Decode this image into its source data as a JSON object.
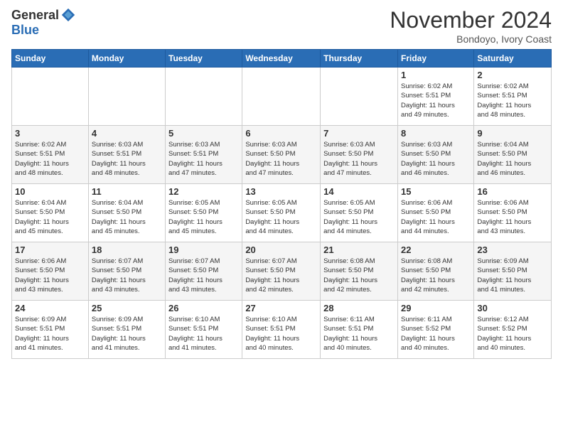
{
  "logo": {
    "general": "General",
    "blue": "Blue"
  },
  "title": "November 2024",
  "subtitle": "Bondoyo, Ivory Coast",
  "days_header": [
    "Sunday",
    "Monday",
    "Tuesday",
    "Wednesday",
    "Thursday",
    "Friday",
    "Saturday"
  ],
  "weeks": [
    [
      {
        "day": "",
        "info": ""
      },
      {
        "day": "",
        "info": ""
      },
      {
        "day": "",
        "info": ""
      },
      {
        "day": "",
        "info": ""
      },
      {
        "day": "",
        "info": ""
      },
      {
        "day": "1",
        "info": "Sunrise: 6:02 AM\nSunset: 5:51 PM\nDaylight: 11 hours\nand 49 minutes."
      },
      {
        "day": "2",
        "info": "Sunrise: 6:02 AM\nSunset: 5:51 PM\nDaylight: 11 hours\nand 48 minutes."
      }
    ],
    [
      {
        "day": "3",
        "info": "Sunrise: 6:02 AM\nSunset: 5:51 PM\nDaylight: 11 hours\nand 48 minutes."
      },
      {
        "day": "4",
        "info": "Sunrise: 6:03 AM\nSunset: 5:51 PM\nDaylight: 11 hours\nand 48 minutes."
      },
      {
        "day": "5",
        "info": "Sunrise: 6:03 AM\nSunset: 5:51 PM\nDaylight: 11 hours\nand 47 minutes."
      },
      {
        "day": "6",
        "info": "Sunrise: 6:03 AM\nSunset: 5:50 PM\nDaylight: 11 hours\nand 47 minutes."
      },
      {
        "day": "7",
        "info": "Sunrise: 6:03 AM\nSunset: 5:50 PM\nDaylight: 11 hours\nand 47 minutes."
      },
      {
        "day": "8",
        "info": "Sunrise: 6:03 AM\nSunset: 5:50 PM\nDaylight: 11 hours\nand 46 minutes."
      },
      {
        "day": "9",
        "info": "Sunrise: 6:04 AM\nSunset: 5:50 PM\nDaylight: 11 hours\nand 46 minutes."
      }
    ],
    [
      {
        "day": "10",
        "info": "Sunrise: 6:04 AM\nSunset: 5:50 PM\nDaylight: 11 hours\nand 45 minutes."
      },
      {
        "day": "11",
        "info": "Sunrise: 6:04 AM\nSunset: 5:50 PM\nDaylight: 11 hours\nand 45 minutes."
      },
      {
        "day": "12",
        "info": "Sunrise: 6:05 AM\nSunset: 5:50 PM\nDaylight: 11 hours\nand 45 minutes."
      },
      {
        "day": "13",
        "info": "Sunrise: 6:05 AM\nSunset: 5:50 PM\nDaylight: 11 hours\nand 44 minutes."
      },
      {
        "day": "14",
        "info": "Sunrise: 6:05 AM\nSunset: 5:50 PM\nDaylight: 11 hours\nand 44 minutes."
      },
      {
        "day": "15",
        "info": "Sunrise: 6:06 AM\nSunset: 5:50 PM\nDaylight: 11 hours\nand 44 minutes."
      },
      {
        "day": "16",
        "info": "Sunrise: 6:06 AM\nSunset: 5:50 PM\nDaylight: 11 hours\nand 43 minutes."
      }
    ],
    [
      {
        "day": "17",
        "info": "Sunrise: 6:06 AM\nSunset: 5:50 PM\nDaylight: 11 hours\nand 43 minutes."
      },
      {
        "day": "18",
        "info": "Sunrise: 6:07 AM\nSunset: 5:50 PM\nDaylight: 11 hours\nand 43 minutes."
      },
      {
        "day": "19",
        "info": "Sunrise: 6:07 AM\nSunset: 5:50 PM\nDaylight: 11 hours\nand 43 minutes."
      },
      {
        "day": "20",
        "info": "Sunrise: 6:07 AM\nSunset: 5:50 PM\nDaylight: 11 hours\nand 42 minutes."
      },
      {
        "day": "21",
        "info": "Sunrise: 6:08 AM\nSunset: 5:50 PM\nDaylight: 11 hours\nand 42 minutes."
      },
      {
        "day": "22",
        "info": "Sunrise: 6:08 AM\nSunset: 5:50 PM\nDaylight: 11 hours\nand 42 minutes."
      },
      {
        "day": "23",
        "info": "Sunrise: 6:09 AM\nSunset: 5:50 PM\nDaylight: 11 hours\nand 41 minutes."
      }
    ],
    [
      {
        "day": "24",
        "info": "Sunrise: 6:09 AM\nSunset: 5:51 PM\nDaylight: 11 hours\nand 41 minutes."
      },
      {
        "day": "25",
        "info": "Sunrise: 6:09 AM\nSunset: 5:51 PM\nDaylight: 11 hours\nand 41 minutes."
      },
      {
        "day": "26",
        "info": "Sunrise: 6:10 AM\nSunset: 5:51 PM\nDaylight: 11 hours\nand 41 minutes."
      },
      {
        "day": "27",
        "info": "Sunrise: 6:10 AM\nSunset: 5:51 PM\nDaylight: 11 hours\nand 40 minutes."
      },
      {
        "day": "28",
        "info": "Sunrise: 6:11 AM\nSunset: 5:51 PM\nDaylight: 11 hours\nand 40 minutes."
      },
      {
        "day": "29",
        "info": "Sunrise: 6:11 AM\nSunset: 5:52 PM\nDaylight: 11 hours\nand 40 minutes."
      },
      {
        "day": "30",
        "info": "Sunrise: 6:12 AM\nSunset: 5:52 PM\nDaylight: 11 hours\nand 40 minutes."
      }
    ]
  ]
}
